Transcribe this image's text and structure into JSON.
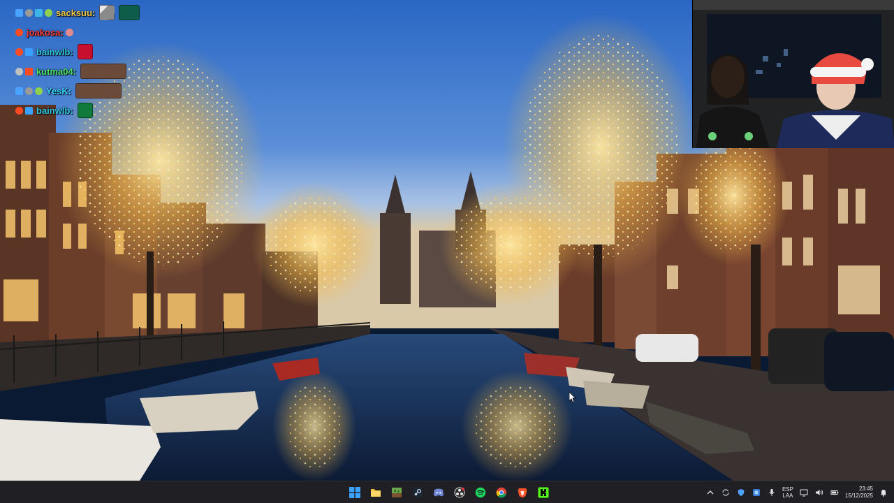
{
  "chat": {
    "messages": [
      {
        "user": "sacksuu:",
        "color": "#f0c84a",
        "badges": [
          "#4aa3ff",
          "#9a9a9a",
          "#3cb4e6",
          "#8fd14f"
        ],
        "emote": "#0e5c4a"
      },
      {
        "user": "joakosa:",
        "color": "#ff3d3d",
        "badges": [
          "#ff4b1f"
        ],
        "emote": ""
      },
      {
        "user": "bainwlb:",
        "color": "#2fc6e0",
        "badges": [
          "#ff4b1f",
          "#3aa0ff"
        ],
        "emote": "#c8102e"
      },
      {
        "user": "kutma04:",
        "color": "#4be36a",
        "badges": [
          "#c0c0c0",
          "#ff4b1f"
        ],
        "emote": "#6b4a3a"
      },
      {
        "user": "YesK:",
        "color": "#36d6ff",
        "badges": [
          "#4aa3ff",
          "#9a9a9a",
          "#8fd14f"
        ],
        "emote": "#6b4a3a"
      },
      {
        "user": "bainwlb:",
        "color": "#2fc6e0",
        "badges": [
          "#ff4b1f",
          "#3aa0ff"
        ],
        "emote": "#0f7a3a"
      }
    ]
  },
  "taskbar": {
    "apps": [
      {
        "name": "start-icon",
        "color": "#3ba3ff"
      },
      {
        "name": "file-explorer-icon",
        "color": "#f4c542"
      },
      {
        "name": "minecraft-icon",
        "color": "#6aa84f"
      },
      {
        "name": "steam-icon",
        "color": "#c7d5e0"
      },
      {
        "name": "discord-icon",
        "color": "#7289da"
      },
      {
        "name": "obs-icon",
        "color": "#e6e6e6"
      },
      {
        "name": "spotify-icon",
        "color": "#1ed760"
      },
      {
        "name": "chrome-icon",
        "color": "#fbbc05"
      },
      {
        "name": "brave-icon",
        "color": "#fb542b"
      },
      {
        "name": "kick-icon",
        "color": "#53fc18"
      }
    ],
    "tray": {
      "lang_top": "ESP",
      "lang_bottom": "LAA",
      "time": "23:45",
      "date": "15/12/2025"
    }
  }
}
